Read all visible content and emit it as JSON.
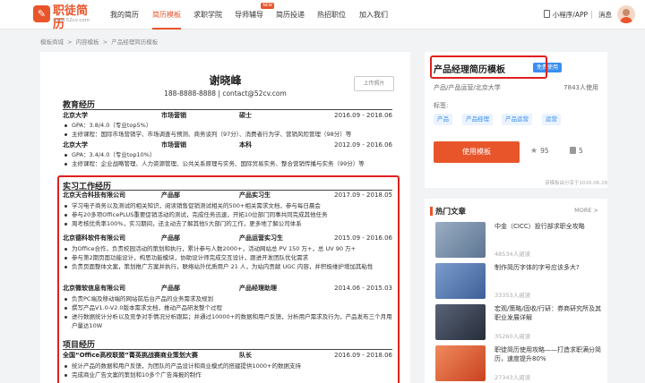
{
  "header": {
    "logo_mark": "✎",
    "logo_name": "职徒简历",
    "logo_url": "www.52cv.com",
    "nav": [
      "我的简历",
      "简历模板",
      "求职学院",
      "导师辅导",
      "简历投递",
      "热招职位",
      "加入我们"
    ],
    "new_badge": "NEW",
    "miniapp": "小程序/APP",
    "messages": "消息"
  },
  "breadcrumb": [
    "模板商城",
    ">",
    "内容模板",
    ">",
    "产品经理简历模板"
  ],
  "resume": {
    "name": "谢晓峰",
    "contact": "188-8888-8888  |  contact@52cv.com",
    "upload_photo": "上传照片",
    "education_title": "教育经历",
    "education": [
      {
        "school": "北京大学",
        "major": "市场营销",
        "degree": "硕士",
        "period": "2016.09 - 2018.06",
        "bullets": [
          "GPA：3.8/4.0（专业top5%）",
          "主修课程：国际市场营销学、市场调查与预测、商务谈判（97分）、消费者行为学、营销风险管理（98分）等"
        ]
      },
      {
        "school": "北京大学",
        "major": "市场营销",
        "degree": "本科",
        "period": "2012.09 - 2016.06",
        "bullets": [
          "GPA：3.4/4.0（专业top10%）",
          "主修课程：企业战略管理、人力资源管理、公共关系原理与实务、国际贸易实务、整合营销传播与实务（99分）等"
        ]
      }
    ],
    "internship_title": "实习工作经历",
    "internships": [
      {
        "company": "北京天合科技有限公司",
        "dept": "产品部",
        "role": "产品实习生",
        "period": "2017.09 - 2018.05",
        "bullets": [
          "学习电子商务以及测试的相关知识，阅读销售促销测试相关的500+相关需求文档，参与每日晨会",
          "参与20多项OfficePLUS重要促销活动的测试，完成任务迅速，开拓10位部门同事共同完成其他任务",
          "周考核优秀率100%，实习期间，还主动去了解其他5大部门的工作，更多地了解公司体系"
        ]
      },
      {
        "company": "北京德科软件有限公司",
        "dept": "产品部",
        "role": "产品运营实习生",
        "period": "2015.09 - 2016.06",
        "bullets": [
          "为Office合作，负责校园活动的策划和执行，累计参与人数2000+，活动网站总 PV 150 万+，总 UV 90 万+",
          "参与第2期页面功能设计，构思功能模块，协助设计师完成交互设计，跟进开发团队优化需求",
          "负责页面整体文案，策划推广方案并执行，联络站外优质用户 21 人，为站内贡献 UGC 内容，并积极维护增加其粘性"
        ]
      },
      {
        "company": "北京微软信息有限公司",
        "dept": "产品部",
        "role": "产品经理助理",
        "period": "2014.06 - 2015.03",
        "bullets": [
          "负责PC端及移动端的网站前后台产品的业务需求及规划",
          "撰写产品V1.0-V2.0版本需求文档，推动产品研发整个过程",
          "进行数据统计分析以及竞争对手情况分析跟踪；并通过10000+的数据和用户反馈，分析用户需求及行为，产品发布三个月用户量达10W"
        ]
      }
    ],
    "project_title": "项目经历",
    "projects": [
      {
        "name": "全国“Office高校联盟”菁英挑战赛商业策划大赛",
        "role": "队长",
        "period": "2016.09 - 2018.06",
        "bullets": [
          "统计产品的数据和用户反馈，为团队的产品设计和商业模式的搭建提供1000+的数据支持",
          "完成商业广告文案的策划和10多个广告海报的制作"
        ]
      }
    ]
  },
  "template": {
    "title": "产品经理简历模板",
    "free_badge": "免费使用",
    "meta": "产品/产品运营/北京大学",
    "users": "7843人使用",
    "tags_label": "标签:",
    "tags": [
      "产品",
      "产品经理",
      "产品运营",
      "运营"
    ],
    "use_button": "使用模板",
    "stars": "95",
    "likes": "5",
    "upload_note": "该模板由分享于2020.06.28"
  },
  "articles": {
    "heading": "热门文章",
    "more": "MORE >",
    "items": [
      {
        "title": "中金（CICC）投行部求职全攻略",
        "reads": "48534人阅读",
        "color": "#7a8fa8"
      },
      {
        "title": "制作简历字体的字号应该多大?",
        "reads": "33353人阅读",
        "color": "#5b7fb5"
      },
      {
        "title": "宏观/策略/固收/行研：券商研究所及其职业发展详解",
        "reads": "35260人阅读",
        "color": "#3f4a5c"
      },
      {
        "title": "职徒简历使用攻略——打造求职满分简历，速度提升80%",
        "reads": "27343人阅读",
        "color": "#e8552b"
      }
    ]
  }
}
